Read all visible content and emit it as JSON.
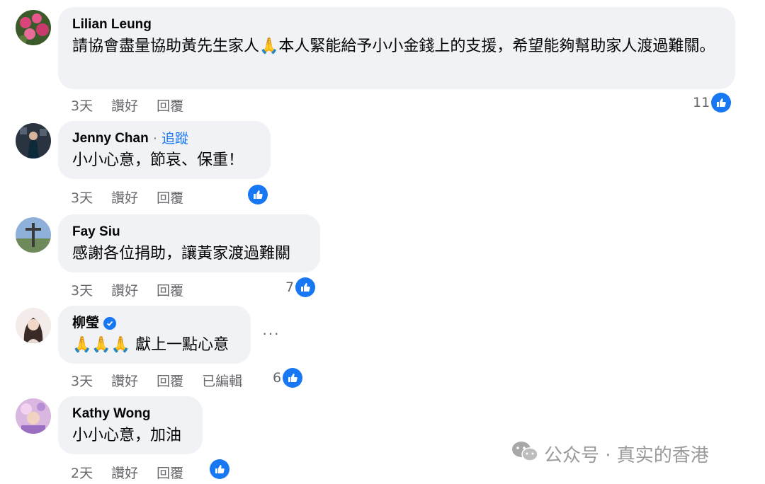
{
  "comments": [
    {
      "name": "Lilian Leung",
      "text": "請協會盡量協助黃先生家人🙏本人緊能給予小小金錢上的支援，希望能夠幫助家人渡過難關。",
      "time": "3天",
      "like": "讚好",
      "reply": "回覆",
      "reactions": "11"
    },
    {
      "name": "Jenny Chan",
      "follow": "追蹤",
      "separator": "·",
      "text": "小小心意，節哀、保重！",
      "time": "3天",
      "like": "讚好",
      "reply": "回覆",
      "reactions": ""
    },
    {
      "name": "Fay Siu",
      "text": "感謝各位捐助，讓黃家渡過難關",
      "time": "3天",
      "like": "讚好",
      "reply": "回覆",
      "reactions": "7"
    },
    {
      "name": "柳瑩",
      "text": "🙏🙏🙏 獻上一點心意",
      "time": "3天",
      "like": "讚好",
      "reply": "回覆",
      "edited": "已編輯",
      "reactions": "6",
      "more": "···"
    },
    {
      "name": "Kathy Wong",
      "text": "小小心意，加油",
      "time": "2天",
      "like": "讚好",
      "reply": "回覆",
      "reactions": ""
    }
  ],
  "watermark": {
    "text": "公众号 · 真实的香港"
  },
  "colors": {
    "accent": "#1877f2",
    "bubble": "#f0f2f5",
    "meta": "#65676b"
  },
  "icons": [
    "like-icon",
    "verified-icon",
    "more-icon",
    "wechat-icon"
  ]
}
